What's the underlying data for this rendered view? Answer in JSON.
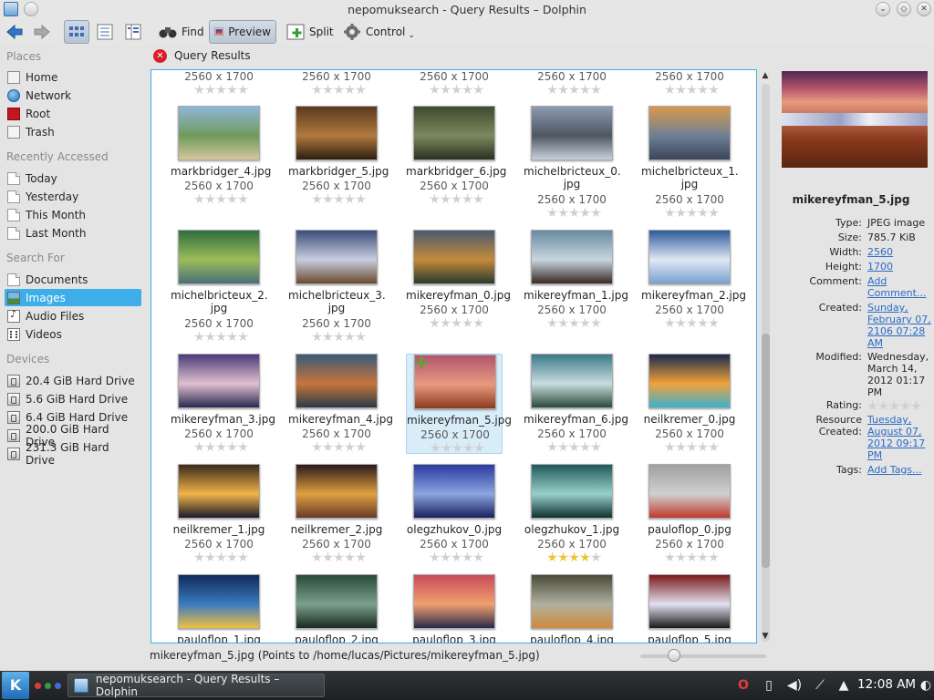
{
  "window": {
    "title": "nepomuksearch - Query Results – Dolphin"
  },
  "toolbar": {
    "find": "Find",
    "preview": "Preview",
    "split": "Split",
    "control": "Control"
  },
  "sidebar": {
    "places": {
      "title": "Places",
      "items": [
        "Home",
        "Network",
        "Root",
        "Trash"
      ]
    },
    "recent": {
      "title": "Recently Accessed",
      "items": [
        "Today",
        "Yesterday",
        "This Month",
        "Last Month"
      ]
    },
    "search": {
      "title": "Search For",
      "items": [
        "Documents",
        "Images",
        "Audio Files",
        "Videos"
      ],
      "selected": "Images"
    },
    "devices": {
      "title": "Devices",
      "items": [
        "20.4 GiB Hard Drive",
        "5.6 GiB Hard Drive",
        "6.4 GiB Hard Drive",
        "200.0 GiB Hard Drive",
        "231.3 GiB Hard Drive"
      ]
    }
  },
  "view": {
    "header": "Query Results",
    "dims": "2560 x 1700",
    "files": [
      {
        "name": "markbridger_4.jpg",
        "rating": 0
      },
      {
        "name": "markbridger_5.jpg",
        "rating": 0
      },
      {
        "name": "markbridger_6.jpg",
        "rating": 0
      },
      {
        "name": "michelbricteux_0.jpg",
        "rating": 0
      },
      {
        "name": "michelbricteux_1.jpg",
        "rating": 0
      },
      {
        "name": "michelbricteux_2.jpg",
        "rating": 0
      },
      {
        "name": "michelbricteux_3.jpg",
        "rating": 0
      },
      {
        "name": "mikereyfman_0.jpg",
        "rating": 0
      },
      {
        "name": "mikereyfman_1.jpg",
        "rating": 0
      },
      {
        "name": "mikereyfman_2.jpg",
        "rating": 0
      },
      {
        "name": "mikereyfman_3.jpg",
        "rating": 0
      },
      {
        "name": "mikereyfman_4.jpg",
        "rating": 0
      },
      {
        "name": "mikereyfman_5.jpg",
        "rating": 0,
        "selected": true
      },
      {
        "name": "mikereyfman_6.jpg",
        "rating": 0
      },
      {
        "name": "neilkremer_0.jpg",
        "rating": 0
      },
      {
        "name": "neilkremer_1.jpg",
        "rating": 0
      },
      {
        "name": "neilkremer_2.jpg",
        "rating": 0
      },
      {
        "name": "olegzhukov_0.jpg",
        "rating": 0
      },
      {
        "name": "olegzhukov_1.jpg",
        "rating": 4
      },
      {
        "name": "pauloflop_0.jpg",
        "rating": 0
      },
      {
        "name": "pauloflop_1.jpg",
        "rating": 0
      },
      {
        "name": "pauloflop_2.jpg",
        "rating": 0
      },
      {
        "name": "pauloflop_3.jpg",
        "rating": 0
      },
      {
        "name": "pauloflop_4.jpg",
        "rating": 0
      },
      {
        "name": "pauloflop_5.jpg",
        "rating": 0
      }
    ]
  },
  "info": {
    "filename": "mikereyfman_5.jpg",
    "type_label": "Type:",
    "type": "JPEG image",
    "size_label": "Size:",
    "size": "785.7 KiB",
    "width_label": "Width:",
    "width": "2560",
    "height_label": "Height:",
    "height": "1700",
    "comment_label": "Comment:",
    "comment": "Add Comment...",
    "created_label": "Created:",
    "created": "Sunday, February 07, 2106 07:28 AM",
    "modified_label": "Modified:",
    "modified": "Wednesday, March 14, 2012 01:17 PM",
    "rating_label": "Rating:",
    "rating": 0,
    "resource_label": "Resource Created:",
    "resource": "Tuesday, August 07, 2012 09:17 PM",
    "tags_label": "Tags:",
    "tags": "Add Tags..."
  },
  "statusbar": {
    "text": "mikereyfman_5.jpg (Points to /home/lucas/Pictures/mikereyfman_5.jpg)"
  },
  "taskbar": {
    "task": "nepomuksearch - Query Results – Dolphin",
    "clock": "12:08 AM"
  }
}
